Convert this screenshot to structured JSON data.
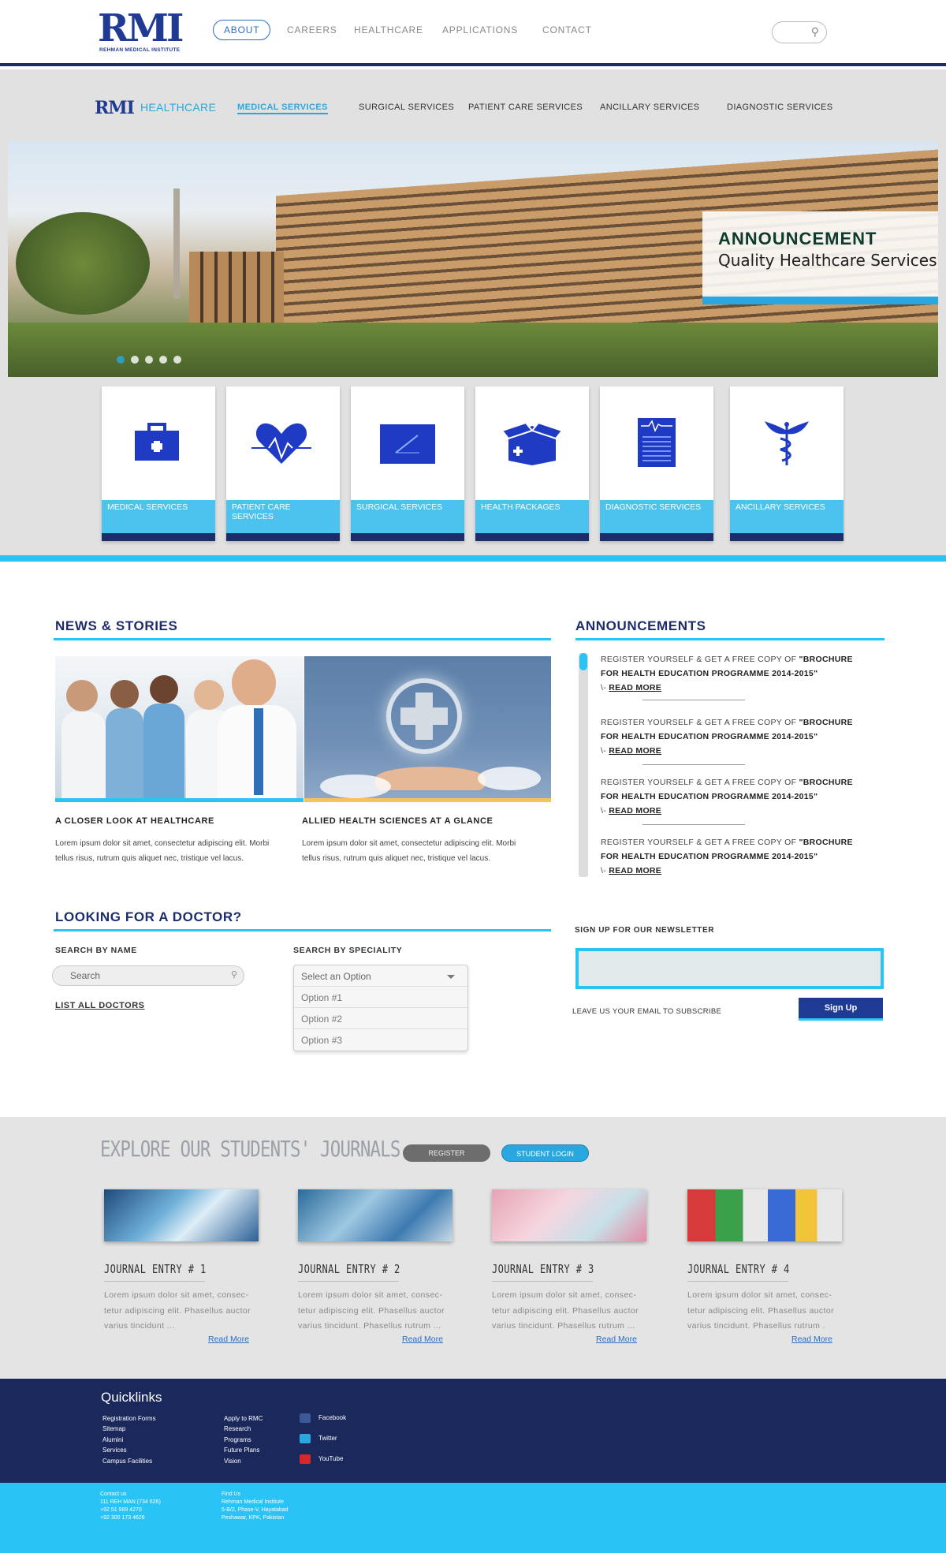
{
  "header": {
    "logo_text": "RMI",
    "logo_subtext": "REHMAN MEDICAL INSTITUTE",
    "nav": [
      "ABOUT",
      "CAREERS",
      "HEALTHCARE",
      "APPLICATIONS",
      "CONTACT"
    ],
    "active_nav": "ABOUT"
  },
  "subheader": {
    "logo_text": "RMI",
    "logo_suffix": "HEALTHCARE",
    "nav": [
      "MEDICAL SERVICES",
      "SURGICAL SERVICES",
      "PATIENT CARE SERVICES",
      "ANCILLARY SERVICES",
      "DIAGNOSTIC SERVICES"
    ],
    "active_nav": "MEDICAL SERVICES"
  },
  "banner": {
    "title": "ANNOUNCEMENT",
    "subtitle": "Quality Healthcare Services",
    "slide_count": 5,
    "active_slide": 0
  },
  "service_cards": [
    {
      "label": "MEDICAL SERVICES",
      "icon": "medical-kit-icon"
    },
    {
      "label": "PATIENT CARE SERVICES",
      "icon": "heartbeat-icon"
    },
    {
      "label": "SURGICAL SERVICES",
      "icon": "scalpel-icon"
    },
    {
      "label": "HEALTH PACKAGES",
      "icon": "package-icon"
    },
    {
      "label": "DIAGNOSTIC SERVICES",
      "icon": "report-icon"
    },
    {
      "label": "ANCILLARY SERVICES",
      "icon": "caduceus-icon"
    }
  ],
  "news": {
    "heading": "NEWS & STORIES",
    "items": [
      {
        "title": "A CLOSER LOOK AT HEALTHCARE",
        "text": "Lorem ipsum dolor sit amet, consectetur adipiscing elit. Morbi tellus risus, rutrum quis aliquet nec, tristique vel lacus.",
        "accent": "#29c3f5"
      },
      {
        "title": "ALLIED HEALTH SCIENCES AT A GLANCE",
        "text": "Lorem ipsum dolor sit amet, consectetur adipiscing elit. Morbi tellus risus, rutrum quis aliquet nec, tristique vel lacus.",
        "accent": "#f2c45a"
      }
    ]
  },
  "announcements": {
    "heading": "ANNOUNCEMENTS",
    "items": [
      {
        "prefix": "REGISTER YOURSELF & GET A FREE COPY OF ",
        "bold": "\"BROCHURE FOR HEALTH EDUCATION PROGRAMME 2014-2015\"",
        "dash": "\\- ",
        "link": "READ MORE"
      },
      {
        "prefix": "REGISTER YOURSELF & GET A FREE COPY OF ",
        "bold": "\"BROCHURE FOR HEALTH EDUCATION PROGRAMME 2014-2015\"",
        "dash": "\\- ",
        "link": "READ MORE"
      },
      {
        "prefix": "REGISTER YOURSELF & GET A FREE COPY OF ",
        "bold": "\"BROCHURE FOR HEALTH EDUCATION PROGRAMME 2014-2015\"",
        "dash": "\\- ",
        "link": "READ MORE"
      },
      {
        "prefix": "REGISTER YOURSELF & GET A FREE COPY OF ",
        "bold": "\"BROCHURE FOR HEALTH EDUCATION PROGRAMME 2014-2015\"",
        "dash": "\\- ",
        "link": "READ MORE"
      }
    ]
  },
  "doctor": {
    "heading": "LOOKING FOR A DOCTOR?",
    "by_name_label": "SEARCH BY NAME",
    "search_placeholder": "Search",
    "list_all": "LIST ALL DOCTORS",
    "by_speciality_label": "SEARCH BY SPECIALITY",
    "select_placeholder": "Select an Option",
    "options": [
      "Option #1",
      "Option #2",
      "Option #3"
    ]
  },
  "newsletter": {
    "heading": "SIGN UP FOR OUR NEWSLETTER",
    "hint": "LEAVE US YOUR EMAIL TO SUBSCRIBE",
    "button": "Sign Up"
  },
  "journals": {
    "heading": "EXPLORE OUR STUDENTS' JOURNALS",
    "register": "REGISTER",
    "login": "STUDENT LOGIN",
    "entries": [
      {
        "title": "JOURNAL ENTRY # 1",
        "text": "Lorem ipsum dolor sit amet, consec-tetur adipiscing elit. Phasellus auctor varius tincidunt ...",
        "more": "Read More"
      },
      {
        "title": "JOURNAL ENTRY # 2",
        "text": "Lorem ipsum dolor sit amet, consec-tetur adipiscing elit. Phasellus auctor varius tincidunt. Phasellus rutrum ...",
        "more": "Read More"
      },
      {
        "title": "JOURNAL ENTRY # 3",
        "text": "Lorem ipsum dolor sit amet, consec-tetur adipiscing elit. Phasellus auctor varius tincidunt. Phasellus rutrum ...",
        "more": "Read More"
      },
      {
        "title": "JOURNAL ENTRY # 4",
        "text": "Lorem ipsum dolor sit amet, consec-tetur adipiscing elit. Phasellus auctor varius tincidunt. Phasellus rutrum .",
        "more": "Read More"
      }
    ]
  },
  "footer": {
    "heading": "Quicklinks",
    "col1": [
      "Registration Forms",
      "Sitemap",
      "Alumini",
      "Services",
      "Campus Facilities"
    ],
    "col2": [
      "Apply to RMC",
      "Research",
      "Programs",
      "Future Plans",
      "Vision"
    ],
    "social": [
      {
        "name": "Facebook",
        "color": "#3b5998",
        "icon": "facebook-icon"
      },
      {
        "name": "Twitter",
        "color": "#29a8e0",
        "icon": "twitter-icon"
      },
      {
        "name": "YouTube",
        "color": "#d62828",
        "icon": "youtube-icon"
      }
    ],
    "contact": [
      "Contact us",
      "111 REH MAN (734 626)",
      "+92 51 989 4270",
      "+92 300 173 4626"
    ],
    "findus": [
      "Find Us",
      "Rehman Medical Institute",
      "5-B/2, Phase-V, Hayatabad",
      "Peshawar, KPK, Pakistan"
    ]
  },
  "colors": {
    "navy": "#1d2c6b",
    "accent": "#29c3f5",
    "brand_blue": "#1f3a93"
  }
}
